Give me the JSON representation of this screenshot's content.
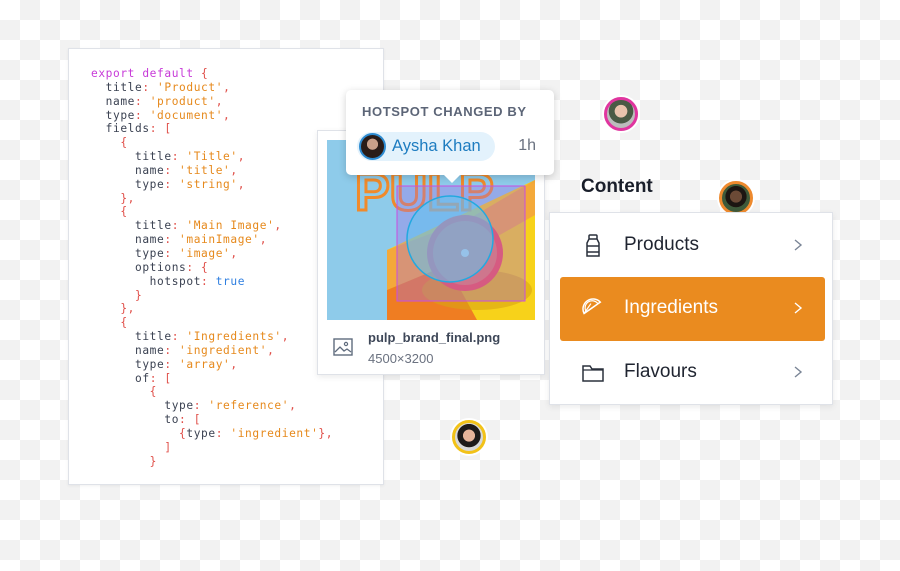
{
  "code_editor": {
    "lines": [
      [
        {
          "t": "export default ",
          "c": "kw"
        },
        {
          "t": "{",
          "c": "pu"
        }
      ],
      [
        {
          "t": "  title",
          "c": "id"
        },
        {
          "t": ": ",
          "c": "pu"
        },
        {
          "t": "'Product'",
          "c": "st"
        },
        {
          "t": ",",
          "c": "pu"
        }
      ],
      [
        {
          "t": "  name",
          "c": "id"
        },
        {
          "t": ": ",
          "c": "pu"
        },
        {
          "t": "'product'",
          "c": "st"
        },
        {
          "t": ",",
          "c": "pu"
        }
      ],
      [
        {
          "t": "  type",
          "c": "id"
        },
        {
          "t": ": ",
          "c": "pu"
        },
        {
          "t": "'document'",
          "c": "st"
        },
        {
          "t": ",",
          "c": "pu"
        }
      ],
      [
        {
          "t": "  fields",
          "c": "id"
        },
        {
          "t": ": [",
          "c": "pu"
        }
      ],
      [
        {
          "t": "    {",
          "c": "pu"
        }
      ],
      [
        {
          "t": "      title",
          "c": "id"
        },
        {
          "t": ": ",
          "c": "pu"
        },
        {
          "t": "'Title'",
          "c": "st"
        },
        {
          "t": ",",
          "c": "pu"
        }
      ],
      [
        {
          "t": "      name",
          "c": "id"
        },
        {
          "t": ": ",
          "c": "pu"
        },
        {
          "t": "'title'",
          "c": "st"
        },
        {
          "t": ",",
          "c": "pu"
        }
      ],
      [
        {
          "t": "      type",
          "c": "id"
        },
        {
          "t": ": ",
          "c": "pu"
        },
        {
          "t": "'string'",
          "c": "st"
        },
        {
          "t": ",",
          "c": "pu"
        }
      ],
      [
        {
          "t": "    },",
          "c": "pu"
        }
      ],
      [
        {
          "t": "    {",
          "c": "pu"
        }
      ],
      [
        {
          "t": "      title",
          "c": "id"
        },
        {
          "t": ": ",
          "c": "pu"
        },
        {
          "t": "'Main Image'",
          "c": "st"
        },
        {
          "t": ",",
          "c": "pu"
        }
      ],
      [
        {
          "t": "      name",
          "c": "id"
        },
        {
          "t": ": ",
          "c": "pu"
        },
        {
          "t": "'mainImage'",
          "c": "st"
        },
        {
          "t": ",",
          "c": "pu"
        }
      ],
      [
        {
          "t": "      type",
          "c": "id"
        },
        {
          "t": ": ",
          "c": "pu"
        },
        {
          "t": "'image'",
          "c": "st"
        },
        {
          "t": ",",
          "c": "pu"
        }
      ],
      [
        {
          "t": "      options",
          "c": "id"
        },
        {
          "t": ": {",
          "c": "pu"
        }
      ],
      [
        {
          "t": "        hotspot",
          "c": "id"
        },
        {
          "t": ": ",
          "c": "pu"
        },
        {
          "t": "true",
          "c": "bo"
        }
      ],
      [
        {
          "t": "      }",
          "c": "pu"
        }
      ],
      [
        {
          "t": "    },",
          "c": "pu"
        }
      ],
      [
        {
          "t": "    {",
          "c": "pu"
        }
      ],
      [
        {
          "t": "      title",
          "c": "id"
        },
        {
          "t": ": ",
          "c": "pu"
        },
        {
          "t": "'Ingredients'",
          "c": "st"
        },
        {
          "t": ",",
          "c": "pu"
        }
      ],
      [
        {
          "t": "      name",
          "c": "id"
        },
        {
          "t": ": ",
          "c": "pu"
        },
        {
          "t": "'ingredient'",
          "c": "st"
        },
        {
          "t": ",",
          "c": "pu"
        }
      ],
      [
        {
          "t": "      type",
          "c": "id"
        },
        {
          "t": ": ",
          "c": "pu"
        },
        {
          "t": "'array'",
          "c": "st"
        },
        {
          "t": ",",
          "c": "pu"
        }
      ],
      [
        {
          "t": "      of",
          "c": "id"
        },
        {
          "t": ": [",
          "c": "pu"
        }
      ],
      [
        {
          "t": "        {",
          "c": "pu"
        }
      ],
      [
        {
          "t": "          type",
          "c": "id"
        },
        {
          "t": ": ",
          "c": "pu"
        },
        {
          "t": "'reference'",
          "c": "st"
        },
        {
          "t": ",",
          "c": "pu"
        }
      ],
      [
        {
          "t": "          to",
          "c": "id"
        },
        {
          "t": ": [",
          "c": "pu"
        }
      ],
      [
        {
          "t": "            {",
          "c": "pu"
        },
        {
          "t": "type",
          "c": "id"
        },
        {
          "t": ": ",
          "c": "pu"
        },
        {
          "t": "'ingredient'",
          "c": "st"
        },
        {
          "t": "},",
          "c": "pu"
        }
      ],
      [
        {
          "t": "          ]",
          "c": "pu"
        }
      ],
      [
        {
          "t": "        }",
          "c": "pu"
        }
      ]
    ]
  },
  "tooltip": {
    "title": "HOTSPOT CHANGED BY",
    "user_name": "Aysha Khan",
    "time": "1h"
  },
  "image_card": {
    "preview_text": "PULP",
    "file_name": "pulp_brand_final.png",
    "dimensions": "4500×3200",
    "icon": "image-icon"
  },
  "content_menu": {
    "heading": "Content",
    "items": [
      {
        "label": "Products",
        "icon": "bottle-icon",
        "active": false
      },
      {
        "label": "Ingredients",
        "icon": "citrus-slice-icon",
        "active": true
      },
      {
        "label": "Flavours",
        "icon": "folder-icon",
        "active": false
      }
    ]
  },
  "colors": {
    "accent": "#ea8b1f",
    "chip_bg": "#e3f2fc",
    "chip_text": "#1d7cc0",
    "hotspot_circle": "#22a9e0",
    "crop_rect": "#c94ee0"
  },
  "presence_avatars": [
    {
      "ring_color": "#e0359f"
    },
    {
      "ring_color": "#ee8a2e"
    },
    {
      "ring_color": "#f2c218"
    }
  ]
}
